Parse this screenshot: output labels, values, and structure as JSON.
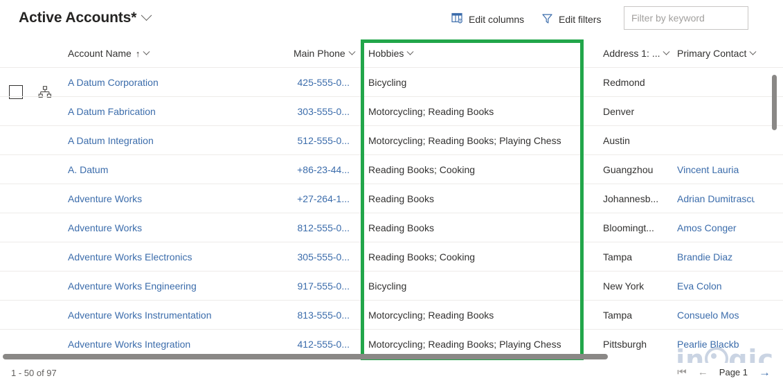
{
  "view": {
    "title": "Active Accounts*",
    "dropdown_icon": "chevron-down-icon"
  },
  "toolbar": {
    "edit_columns_label": "Edit columns",
    "edit_columns_icon": "edit-columns-icon",
    "edit_filters_label": "Edit filters",
    "edit_filters_icon": "funnel-icon",
    "filter_placeholder": "Filter by keyword",
    "filter_value": ""
  },
  "grid": {
    "select_all_icon": "checkbox-unchecked-icon",
    "hierarchy_icon": "org-chart-icon",
    "columns": [
      {
        "label": "Account Name",
        "sort": "↑",
        "menu_icon": "chevron-down-icon"
      },
      {
        "label": "Main Phone",
        "sort": "",
        "menu_icon": "chevron-down-icon"
      },
      {
        "label": "Hobbies",
        "sort": "",
        "menu_icon": "chevron-down-icon"
      },
      {
        "label": "Address 1: ...",
        "sort": "",
        "menu_icon": "chevron-down-icon"
      },
      {
        "label": "Primary Contact",
        "sort": "",
        "menu_icon": "chevron-down-icon"
      }
    ],
    "rows": [
      {
        "name": "A Datum Corporation",
        "phone": "425-555-0...",
        "hobbies": "Bicycling",
        "address": "Redmond",
        "contact": ""
      },
      {
        "name": "A Datum Fabrication",
        "phone": "303-555-0...",
        "hobbies": "Motorcycling; Reading Books",
        "address": "Denver",
        "contact": ""
      },
      {
        "name": "A Datum Integration",
        "phone": "512-555-0...",
        "hobbies": "Motorcycling; Reading Books; Playing Chess",
        "address": "Austin",
        "contact": ""
      },
      {
        "name": "A. Datum",
        "phone": "+86-23-44...",
        "hobbies": "Reading Books; Cooking",
        "address": "Guangzhou",
        "contact": "Vincent Lauria"
      },
      {
        "name": "Adventure Works",
        "phone": "+27-264-1...",
        "hobbies": "Reading Books",
        "address": "Johannesb...",
        "contact": "Adrian Dumitrascu"
      },
      {
        "name": "Adventure Works",
        "phone": "812-555-0...",
        "hobbies": "Reading Books",
        "address": "Bloomingt...",
        "contact": "Amos Conger"
      },
      {
        "name": "Adventure Works Electronics",
        "phone": "305-555-0...",
        "hobbies": "Reading Books; Cooking",
        "address": "Tampa",
        "contact": "Brandie Diaz"
      },
      {
        "name": "Adventure Works Engineering",
        "phone": "917-555-0...",
        "hobbies": "Bicycling",
        "address": "New York",
        "contact": "Eva Colon"
      },
      {
        "name": "Adventure Works Instrumentation",
        "phone": "813-555-0...",
        "hobbies": "Motorcycling; Reading Books",
        "address": "Tampa",
        "contact": "Consuelo Mos"
      },
      {
        "name": "Adventure Works Integration",
        "phone": "412-555-0...",
        "hobbies": "Motorcycling; Reading Books; Playing Chess",
        "address": "Pittsburgh",
        "contact": "Pearlie Blackb"
      }
    ]
  },
  "highlight": {
    "color": "#22a64a",
    "target_column": "Hobbies"
  },
  "footer": {
    "record_count": "1 - 50 of 97",
    "first_page_icon": "page-first-icon",
    "prev_page_icon": "arrow-left-icon",
    "page_label": "Page 1",
    "next_page_icon": "arrow-right-icon"
  },
  "watermark": {
    "text_a": "in",
    "text_b": "gic",
    "color": "#b9c6da"
  }
}
